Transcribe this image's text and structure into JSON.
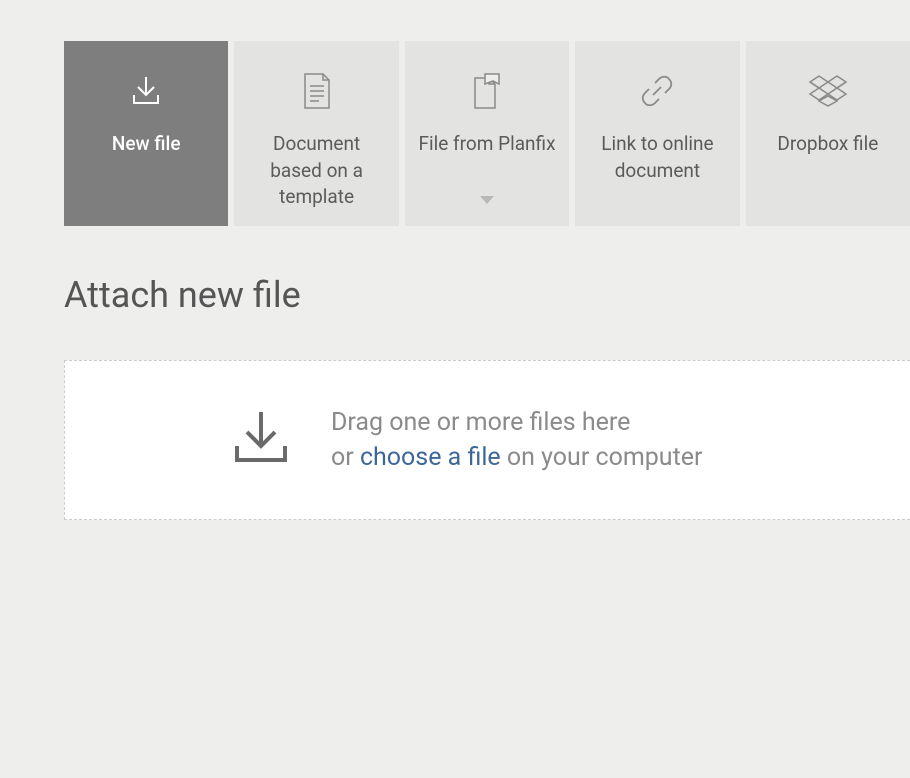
{
  "tabs": [
    {
      "label": "New file"
    },
    {
      "label": "Document based on a template"
    },
    {
      "label": "File from Planfix"
    },
    {
      "label": "Link to online document"
    },
    {
      "label": "Dropbox file"
    }
  ],
  "heading": "Attach new file",
  "dropzone": {
    "line1": "Drag one or more files here",
    "line2_prefix": "or ",
    "line2_link": "choose a file",
    "line2_suffix": " on your computer"
  }
}
